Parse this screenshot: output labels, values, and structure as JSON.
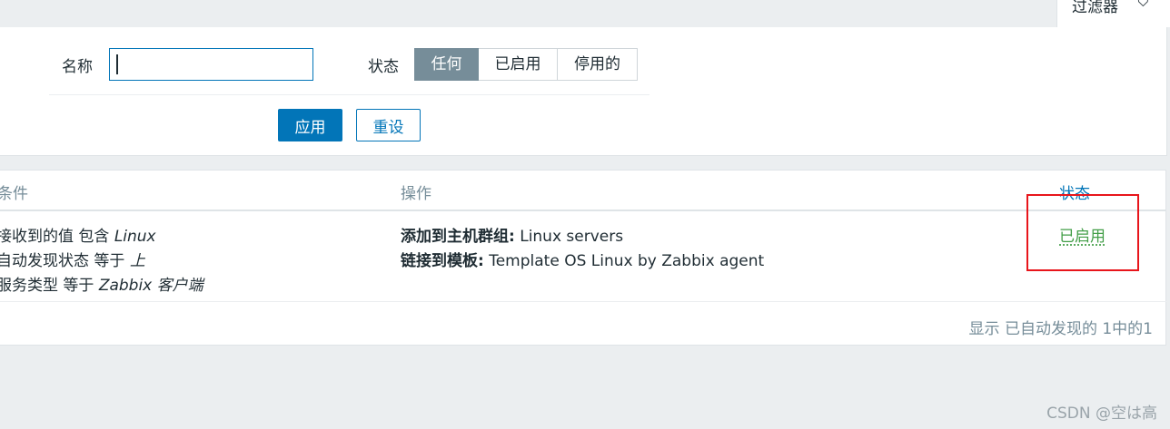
{
  "filter_tab": {
    "label": "过滤器",
    "icon": "filter-icon"
  },
  "filter": {
    "name_label": "名称",
    "name_value": "",
    "status_label": "状态",
    "status_options": [
      "任何",
      "已启用",
      "停用的"
    ],
    "status_selected": "任何",
    "apply_label": "应用",
    "reset_label": "重设"
  },
  "table": {
    "headers": {
      "conditions": "条件",
      "operations": "操作",
      "status": "状态"
    },
    "row": {
      "conditions": [
        {
          "text": "接收到的值 包含 ",
          "value": "Linux"
        },
        {
          "text": "自动发现状态 等于 ",
          "value": "上"
        },
        {
          "text": "服务类型 等于 ",
          "value": "Zabbix 客户端"
        }
      ],
      "operations": [
        {
          "label": "添加到主机群组:",
          "value": " Linux servers"
        },
        {
          "label": "链接到模板:",
          "value": " Template OS Linux by Zabbix agent"
        }
      ],
      "status": "已启用"
    },
    "footer": "显示 已自动发现的 1中的1"
  },
  "watermark": "CSDN @空は高",
  "colors": {
    "primary": "#0275b8",
    "enabled": "#429e47",
    "highlight": "#e8151b",
    "segment_active": "#768d99"
  }
}
